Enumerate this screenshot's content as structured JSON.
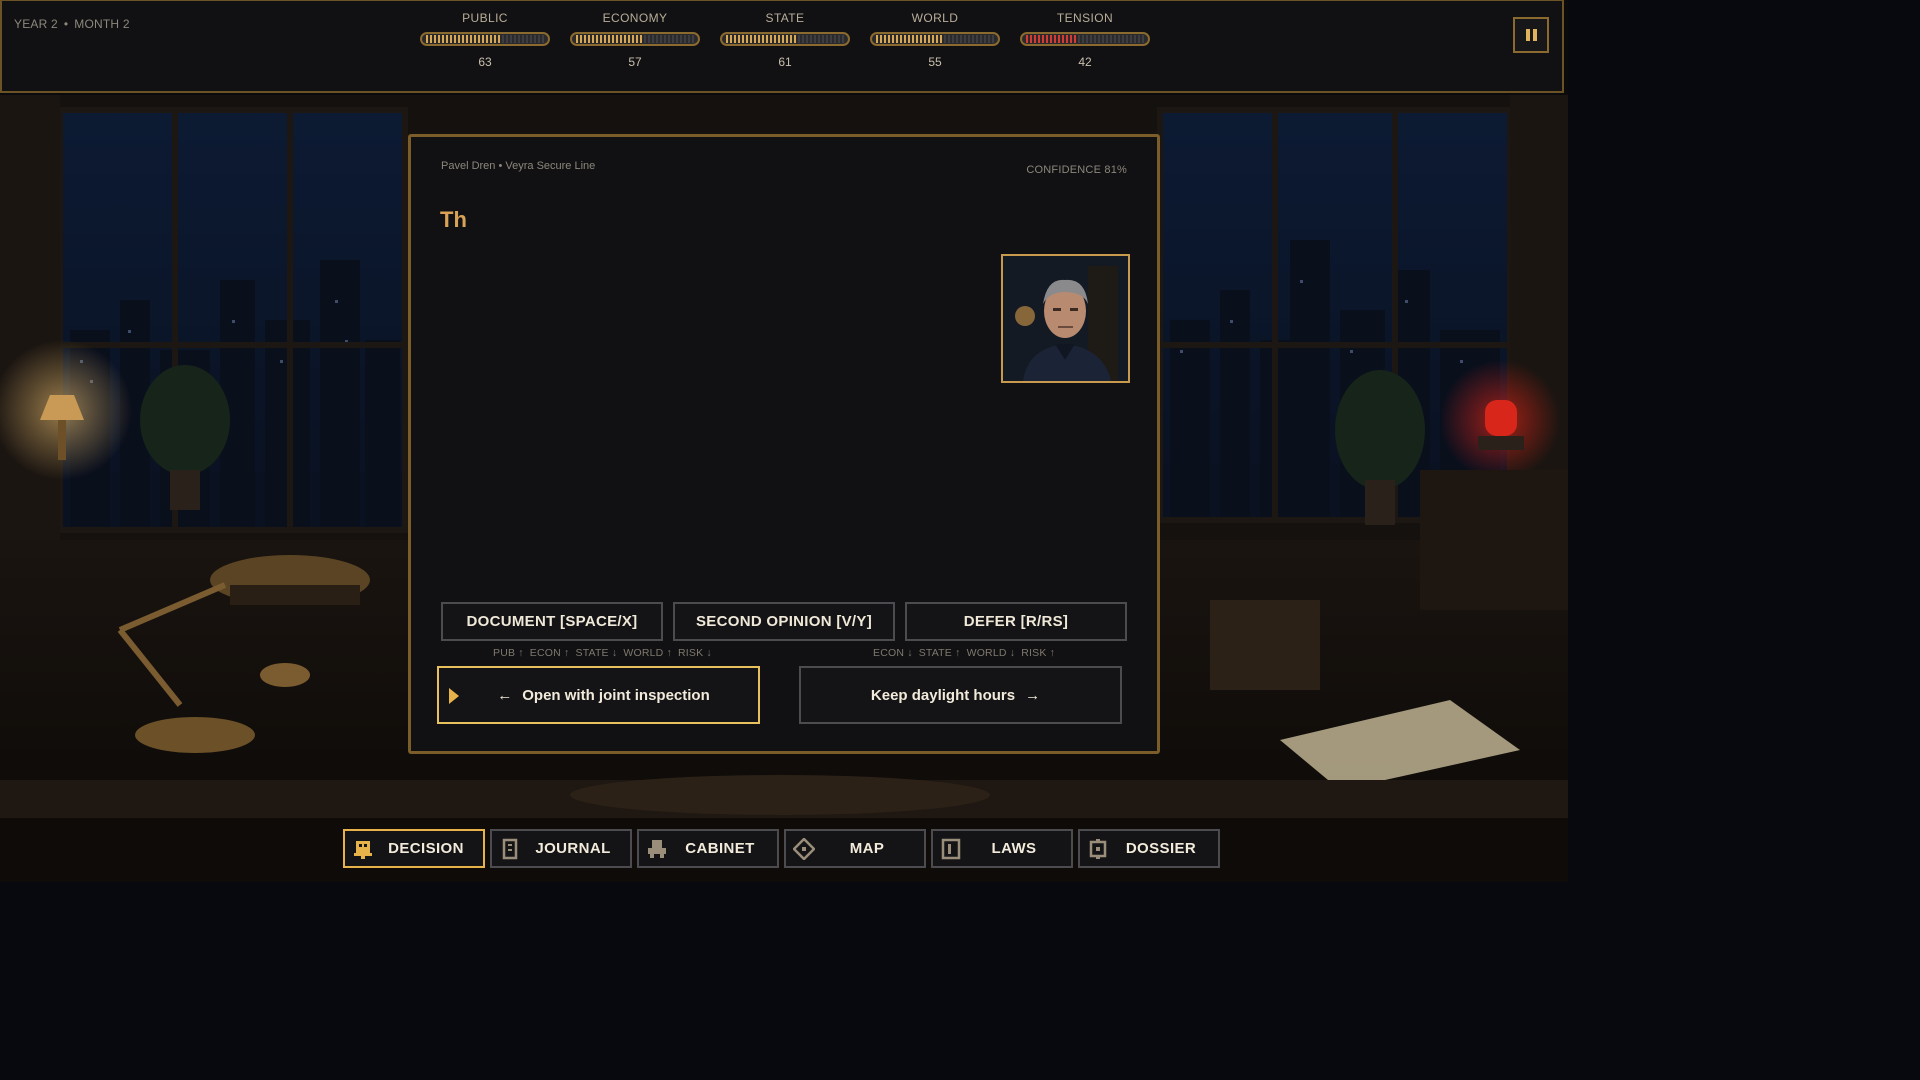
{
  "hud": {
    "date": {
      "year": "YEAR 2",
      "separator": "•",
      "month": "MONTH 2"
    },
    "meters": [
      {
        "label": "PUBLIC",
        "value": 63,
        "color": "#d8a855"
      },
      {
        "label": "ECONOMY",
        "value": 57,
        "color": "#d8a855"
      },
      {
        "label": "STATE",
        "value": 61,
        "color": "#d8a855"
      },
      {
        "label": "WORLD",
        "value": 55,
        "color": "#d8a855"
      },
      {
        "label": "TENSION",
        "value": 42,
        "color": "#d63a33"
      }
    ],
    "pause_icon": "pause-icon"
  },
  "card": {
    "sender": "Pavel Dren • Veyra Secure Line",
    "confidence": "CONFIDENCE 81%",
    "headline": "Th",
    "portrait": "advisor-portrait",
    "actions": [
      {
        "label": "DOCUMENT [SPACE/X]"
      },
      {
        "label": "SECOND OPINION [V/Y]"
      },
      {
        "label": "DEFER [R/RS]"
      }
    ],
    "left_effects": [
      "PUB ↑",
      "ECON ↑",
      "STATE ↓",
      "WORLD ↑",
      "RISK ↓"
    ],
    "right_effects": [
      "ECON ↓",
      "STATE ↑",
      "WORLD ↓",
      "RISK ↑"
    ],
    "choice_left": {
      "arrow": "←",
      "label": "Open with joint inspection"
    },
    "choice_right": {
      "label": "Keep daylight hours",
      "arrow": "→"
    }
  },
  "nav": {
    "tabs": [
      {
        "label": "DECISION",
        "icon": "decision-icon",
        "active": true
      },
      {
        "label": "JOURNAL",
        "icon": "journal-icon",
        "active": false
      },
      {
        "label": "CABINET",
        "icon": "cabinet-icon",
        "active": false
      },
      {
        "label": "MAP",
        "icon": "map-icon",
        "active": false
      },
      {
        "label": "LAWS",
        "icon": "laws-icon",
        "active": false
      },
      {
        "label": "DOSSIER",
        "icon": "dossier-icon",
        "active": false
      }
    ]
  },
  "colors": {
    "accent": "#e7b24a",
    "card_border": "#7a5d28",
    "tension": "#d63a33"
  }
}
